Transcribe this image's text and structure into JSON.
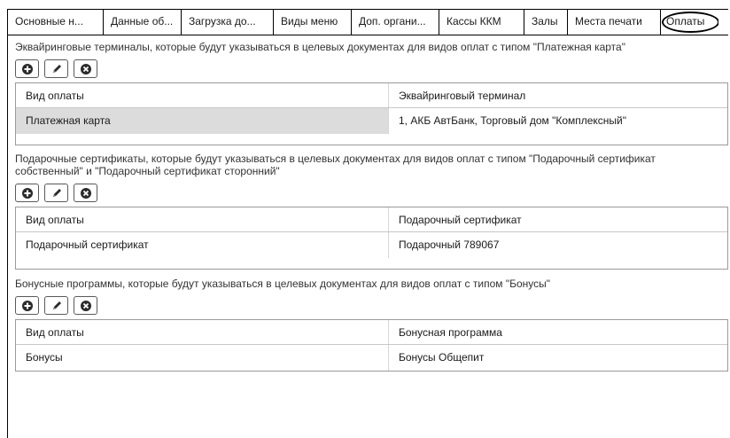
{
  "tabs": [
    {
      "label": "Основные н..."
    },
    {
      "label": "Данные об..."
    },
    {
      "label": "Загрузка до..."
    },
    {
      "label": "Виды меню"
    },
    {
      "label": "Доп. органи..."
    },
    {
      "label": "Кассы ККМ"
    },
    {
      "label": "Залы"
    },
    {
      "label": "Места печати"
    },
    {
      "label": "Оплаты"
    }
  ],
  "active_tab": "Оплаты",
  "toolbar": {
    "add_icon": "plus-circle-icon",
    "edit_icon": "pencil-icon",
    "delete_icon": "x-circle-icon"
  },
  "sections": [
    {
      "description": "Эквайринговые терминалы, которые будут указываться в целевых документах для видов оплат с типом \"Платежная карта\"",
      "columns": [
        "Вид оплаты",
        "Эквайринговый терминал"
      ],
      "rows": [
        [
          "Платежная карта",
          "1, АКБ АвтБанк, Торговый дом \"Комплексный\""
        ]
      ]
    },
    {
      "description": "Подарочные сертификаты, которые будут указываться в целевых документах для видов оплат с типом \"Подарочный сертификат собственный\" и \"Подарочный сертификат сторонний\"",
      "columns": [
        "Вид оплаты",
        "Подарочный сертификат"
      ],
      "rows": [
        [
          "Подарочный сертификат",
          "Подарочный 789067"
        ]
      ]
    },
    {
      "description": "Бонусные программы, которые будут указываться в целевых документах для видов оплат с типом \"Бонусы\"",
      "columns": [
        "Вид оплаты",
        "Бонусная программа"
      ],
      "rows": [
        [
          "Бонусы",
          "Бонусы Общепит"
        ]
      ]
    }
  ],
  "colors": {
    "selected_cell": "#dcdcdc",
    "grid_border": "#9a9a9a"
  }
}
